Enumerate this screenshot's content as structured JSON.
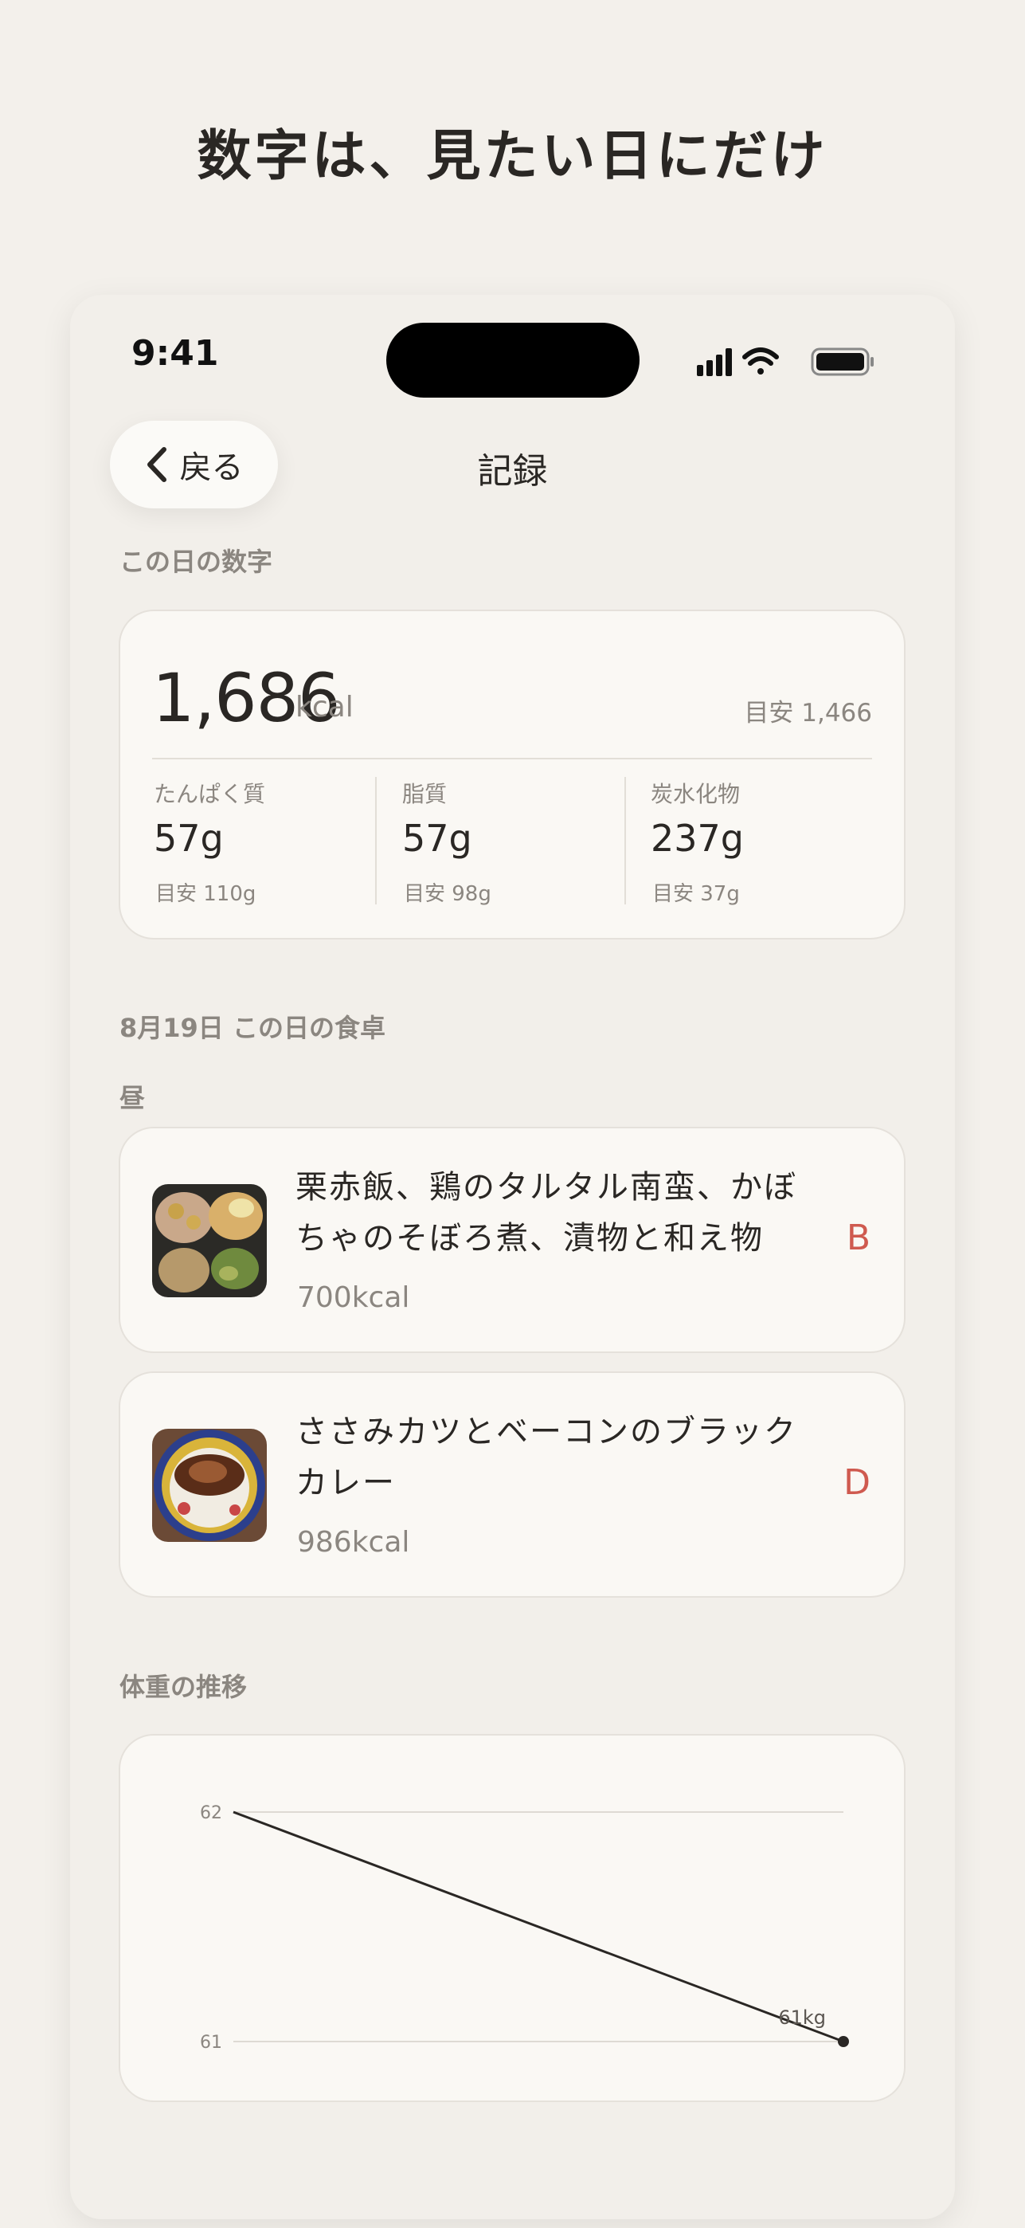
{
  "headline": "数字は、見たい日にだけ",
  "status_bar": {
    "time": "9:41"
  },
  "nav": {
    "back_label": "戻る",
    "title": "記録"
  },
  "day_numbers": {
    "section_label": "この日の数字",
    "calories": "1,686",
    "calories_unit": "kcal",
    "calories_target": "目安 1,466",
    "macros": [
      {
        "label": "たんぱく質",
        "value": "57g",
        "target": "目安 110g"
      },
      {
        "label": "脂質",
        "value": "57g",
        "target": "目安 98g"
      },
      {
        "label": "炭水化物",
        "value": "237g",
        "target": "目安 37g"
      }
    ]
  },
  "meals": {
    "date_label": "8月19日  この日の食卓",
    "slot_label": "昼",
    "items": [
      {
        "name": "栗赤飯、鶏のタルタル南蛮、かぼちゃのそぼろ煮、漬物と和え物",
        "kcal": "700kcal",
        "grade": "B"
      },
      {
        "name": "ささみカツとベーコンのブラックカレー",
        "kcal": "986kcal",
        "grade": "D"
      }
    ]
  },
  "weight": {
    "section_label": "体重の推移"
  },
  "chart_data": {
    "type": "line",
    "title": "",
    "xlabel": "",
    "ylabel": "",
    "y_ticks": [
      "62",
      "61"
    ],
    "ylim": [
      61,
      62
    ],
    "series": [
      {
        "values": [
          62,
          61
        ],
        "end_label": "61kg"
      }
    ],
    "grid": true
  },
  "colors": {
    "accent_grade": "#cf5a4f",
    "background": "#f3f0eb",
    "card": "#faf8f4"
  }
}
